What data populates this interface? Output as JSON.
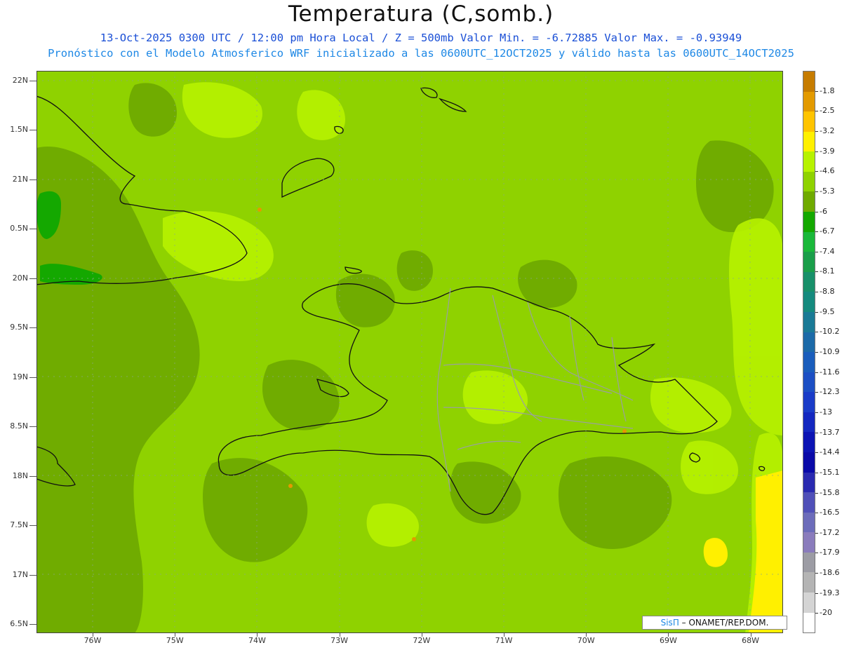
{
  "title": "Temperatura (C,somb.)",
  "subtitle_line1": "13-Oct-2025  0300 UTC / 12:00 pm Hora Local / Z = 500mb  Valor Min. = -6.72885  Valor Max. = -0.93949",
  "subtitle_line2": "Pronóstico con el Modelo Atmosferico WRF inicializado a las 0600UTC_12OCT2025 y válido hasta las  0600UTC_14OCT2025",
  "credit": {
    "brand": "SisΠ",
    "text": "– ONAMET/REP.DOM."
  },
  "y_labels": [
    "22N",
    "1.5N",
    "21N",
    "0.5N",
    "20N",
    "9.5N",
    "19N",
    "8.5N",
    "18N",
    "7.5N",
    "17N",
    "6.5N"
  ],
  "x_labels": [
    "76W",
    "75W",
    "74W",
    "73W",
    "72W",
    "71W",
    "70W",
    "69W",
    "68W"
  ],
  "colorbar": {
    "labels": [
      "-1.8",
      "-2.5",
      "-3.2",
      "-3.9",
      "-4.6",
      "-5.3",
      "-6",
      "-6.7",
      "-7.4",
      "-8.1",
      "-8.8",
      "-9.5",
      "-10.2",
      "-10.9",
      "-11.6",
      "-12.3",
      "-13",
      "-13.7",
      "-14.4",
      "-15.1",
      "-15.8",
      "-16.5",
      "-17.2",
      "-17.9",
      "-18.6",
      "-19.3",
      "-20"
    ],
    "colors": [
      "#c67c00",
      "#e39a00",
      "#ffc400",
      "#fff000",
      "#b7f200",
      "#8fd200",
      "#6faa00",
      "#14a800",
      "#1ab83a",
      "#1a9e4a",
      "#18906a",
      "#158a7e",
      "#1a7a96",
      "#1c6aa8",
      "#1a5dbc",
      "#1c4fc4",
      "#1a3cc8",
      "#1428c0",
      "#0c14b4",
      "#0a0aa8",
      "#2a2ab0",
      "#5050b8",
      "#6c6cba",
      "#8a7cbc",
      "#9c9ca4",
      "#b4b4b4",
      "#d4d4d4",
      "#ffffff"
    ]
  },
  "field_colors": {
    "base": "#8fd200",
    "warm": "#b7f200",
    "cool": "#6faa00",
    "cold": "#14a800",
    "hot": "#fff000",
    "coast": "#111111",
    "border": "#9aa0a0"
  }
}
